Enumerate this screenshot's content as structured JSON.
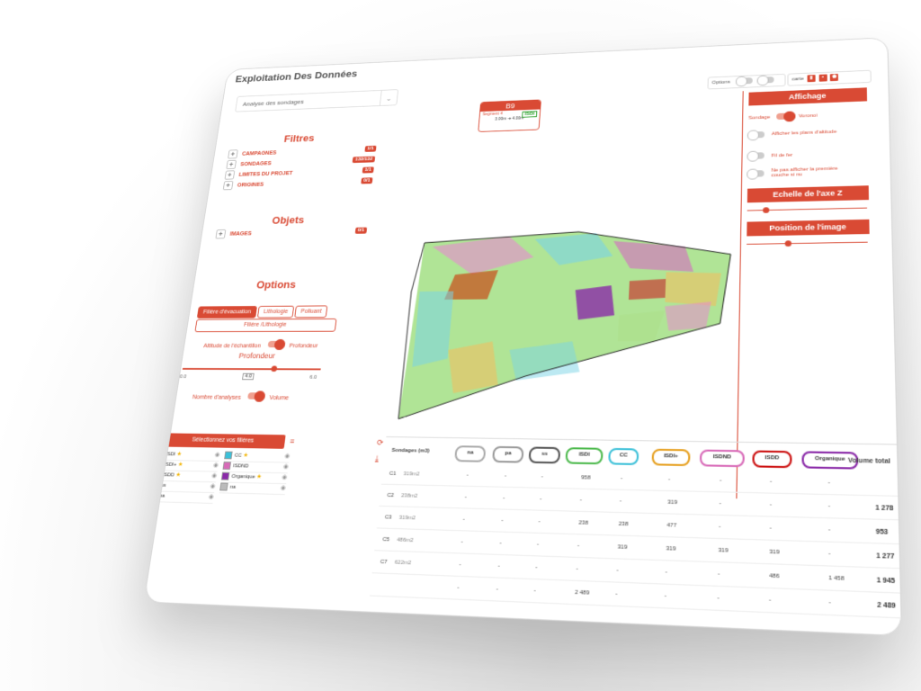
{
  "page": {
    "title": "Exploitation Des Données"
  },
  "analysis_select": {
    "value": "Analyse des sondages"
  },
  "filters": {
    "title": "Filtres",
    "items": [
      {
        "label": "CAMPAGNES",
        "count": "1/1"
      },
      {
        "label": "SONDAGES",
        "count": "132/132"
      },
      {
        "label": "LIMITES DU PROJET",
        "count": "1/1"
      },
      {
        "label": "ORIGINES",
        "count": "0/1"
      }
    ]
  },
  "objects": {
    "title": "Objets",
    "items": [
      {
        "label": "IMAGES",
        "count": "0/1"
      }
    ]
  },
  "options": {
    "title": "Options",
    "tabs": [
      "Filière d'évacuation",
      "Lithologie",
      "Polluant"
    ],
    "tab2": "Filière /Lithologie",
    "altitude_label": "Altitude de l'échantillon",
    "profondeur_label": "Profondeur",
    "depth_title": "Profondeur",
    "depth_min": "0.0",
    "depth_value": "4.0",
    "depth_max": "6.0",
    "depth_fraction": 0.667,
    "analyses_label": "Nombre d'analyses",
    "volume_label": "Volume"
  },
  "select_filieres": {
    "label": "Sélectionnez vos filières"
  },
  "legend": [
    {
      "name": "ISDI",
      "color": "#4cb94c",
      "star": true
    },
    {
      "name": "ISDI+",
      "color": "#e6a020",
      "star": true
    },
    {
      "name": "ISDD",
      "color": "#cc1111",
      "star": true
    },
    {
      "name": "ss",
      "color": "#555555",
      "star": false
    },
    {
      "name": "pa",
      "color": "#999999",
      "star": false
    },
    {
      "name": "CC",
      "color": "#3cc0d8",
      "star": true
    },
    {
      "name": "ISDND",
      "color": "#d86ab8",
      "star": false
    },
    {
      "name": "Organique",
      "color": "#8a2aa8",
      "star": true
    },
    {
      "name": "na",
      "color": "#bbbbbb",
      "star": false
    }
  ],
  "sondage_card": {
    "id": "B9",
    "segment": "Segment 4",
    "badge": "ISDI",
    "from": "3.00m",
    "to": "4.00m"
  },
  "top_controls": {
    "options_label": "Options",
    "carte_label": "carte"
  },
  "affichage": {
    "title": "Affichage",
    "sondage_label": "Sondage",
    "voronoi_label": "Voronoi",
    "plans_label": "Afficher les plans d'altitude",
    "fil_label": "Fil de fer",
    "premiere_label": "Ne pas afficher la première couche si nu",
    "z_scale_title": "Echelle de l'axe Z",
    "z_scale_fraction": 0.16,
    "image_position_title": "Position de l'image",
    "image_position_fraction": 0.34
  },
  "table": {
    "corner": "Sondages (m3)",
    "columns": [
      {
        "name": "na",
        "color": "#aaaaaa"
      },
      {
        "name": "pa",
        "color": "#999999"
      },
      {
        "name": "ss",
        "color": "#555555"
      },
      {
        "name": "ISDI",
        "color": "#4cb94c"
      },
      {
        "name": "CC",
        "color": "#3cc0d8"
      },
      {
        "name": "ISDI+",
        "color": "#e6a020"
      },
      {
        "name": "ISDND",
        "color": "#d86ab8"
      },
      {
        "name": "ISDD",
        "color": "#cc1111"
      },
      {
        "name": "Organique",
        "color": "#8a2aa8"
      }
    ],
    "total_header": "Volume total",
    "rows": [
      {
        "id": "C1",
        "area": "319m2",
        "values": [
          "-",
          "-",
          "-",
          "958",
          "-",
          "-",
          "-",
          "-",
          "-"
        ],
        "total": ""
      },
      {
        "id": "C2",
        "area": "238m2",
        "values": [
          "-",
          "-",
          "-",
          "-",
          "-",
          "319",
          "-",
          "-",
          "-"
        ],
        "total": "1 278"
      },
      {
        "id": "C3",
        "area": "319m2",
        "values": [
          "-",
          "-",
          "-",
          "238",
          "238",
          "477",
          "-",
          "-",
          "-"
        ],
        "total": "953"
      },
      {
        "id": "C5",
        "area": "486m2",
        "values": [
          "-",
          "-",
          "-",
          "-",
          "319",
          "319",
          "319",
          "319",
          "-"
        ],
        "total": "1 277"
      },
      {
        "id": "C7",
        "area": "622m2",
        "values": [
          "-",
          "-",
          "-",
          "-",
          "-",
          "-",
          "-",
          "486",
          "1 458"
        ],
        "total": "1 945"
      },
      {
        "id": "",
        "area": "",
        "values": [
          "-",
          "-",
          "-",
          "2 489",
          "-",
          "-",
          "-",
          "-",
          "-"
        ],
        "total": "2 489"
      }
    ]
  }
}
